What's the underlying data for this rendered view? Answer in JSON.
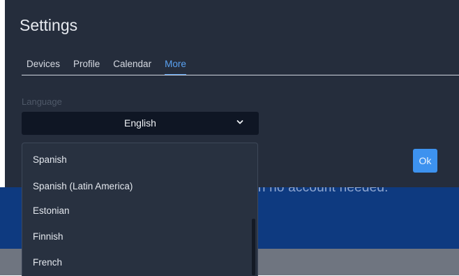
{
  "settings": {
    "title": "Settings"
  },
  "tabs": [
    {
      "label": "Devices",
      "active": false
    },
    {
      "label": "Profile",
      "active": false
    },
    {
      "label": "Calendar",
      "active": false
    },
    {
      "label": "More",
      "active": true
    }
  ],
  "language": {
    "label": "Language",
    "selected": "English",
    "options": [
      "Spanish",
      "Spanish (Latin America)",
      "Estonian",
      "Finnish",
      "French"
    ]
  },
  "ok_label": "Ok",
  "background": {
    "banner_text": "ith no account needed."
  },
  "colors": {
    "panel": "#252d3c",
    "accent": "#5aa2f2",
    "button": "#3d92ef",
    "banner": "#0e3a80"
  },
  "icons": {
    "dropdown": "chevron-down-icon"
  }
}
